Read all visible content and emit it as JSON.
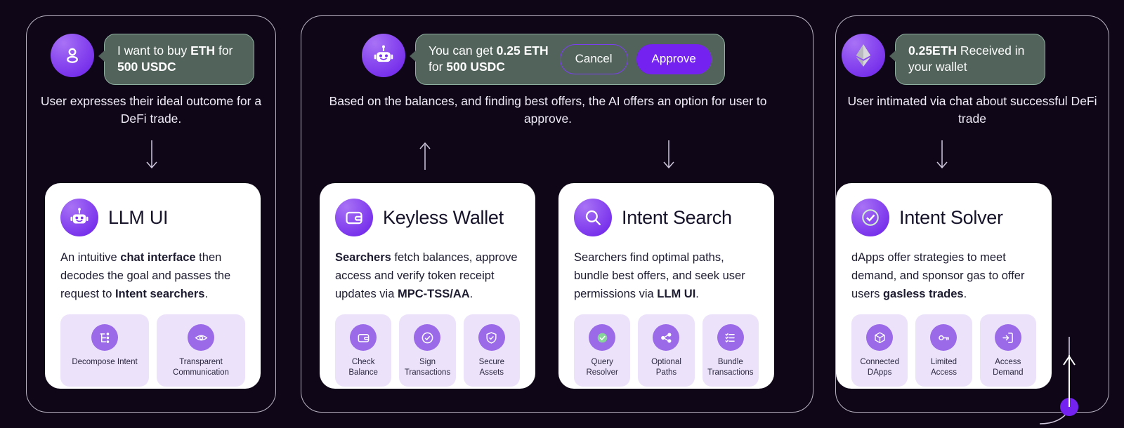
{
  "theme": {
    "background": "#0f0718",
    "panel_border": "#b9b3c4",
    "bubble_bg": "#51635a",
    "bubble_border": "#8fb0a0",
    "accent_purple": "#7322f0",
    "chip_bg": "#ece3fb",
    "chip_icon_bg": "#9a6ae8",
    "card_bg": "#ffffff",
    "caption_color": "#efeaf6",
    "green_check": "#86d49a"
  },
  "panels": [
    {
      "name": "user-panel",
      "chat": {
        "avatar_icon": "user-icon",
        "message_parts": [
          {
            "text": "I want to buy ",
            "bold": false
          },
          {
            "text": "ETH",
            "bold": true
          },
          {
            "text": " for ",
            "bold": false
          },
          {
            "text": "500 USDC",
            "bold": true
          }
        ],
        "plain_message": "I want to buy ETH for 500 USDC",
        "buttons": []
      },
      "caption": "User expresses their ideal outcome for a DeFi trade.",
      "arrow": "down-arrow-icon"
    },
    {
      "name": "ai-panel",
      "chat": {
        "avatar_icon": "robot-icon",
        "message_parts": [
          {
            "text": "You can get ",
            "bold": false
          },
          {
            "text": "0.25 ETH",
            "bold": true
          },
          {
            "text": " for ",
            "bold": false
          },
          {
            "text": "500 USDC",
            "bold": true
          }
        ],
        "plain_message": "You can get 0.25 ETH for 500 USDC",
        "buttons": [
          {
            "label": "Cancel",
            "style": "outline"
          },
          {
            "label": "Approve",
            "style": "filled"
          }
        ]
      },
      "caption": "Based on the balances, and finding best offers, the AI offers an option for user to approve.",
      "arrows": [
        "up-arrow-icon",
        "down-arrow-icon"
      ]
    },
    {
      "name": "result-panel",
      "chat": {
        "avatar_icon": "ethereum-icon",
        "message_parts": [
          {
            "text": "0.25ETH",
            "bold": true
          },
          {
            "text": " Received in your wallet",
            "bold": false
          }
        ],
        "plain_message": "0.25ETH Received in your wallet",
        "buttons": []
      },
      "caption": "User intimated via chat about successful DeFi trade",
      "arrow": "down-arrow-icon"
    }
  ],
  "cards": [
    {
      "id": "llm-ui",
      "icon": "robot-icon",
      "title": "LLM UI",
      "description_parts": [
        {
          "text": "An intuitive ",
          "bold": false
        },
        {
          "text": "chat interface",
          "bold": true
        },
        {
          "text": " then decodes the goal and passes the request to ",
          "bold": false
        },
        {
          "text": "Intent searchers",
          "bold": true
        },
        {
          "text": ".",
          "bold": false
        }
      ],
      "chips": [
        {
          "icon": "decompose-icon",
          "label": "Decompose Intent"
        },
        {
          "icon": "eye-icon",
          "label": "Transparent\nCommunication"
        }
      ]
    },
    {
      "id": "keyless-wallet",
      "icon": "wallet-icon",
      "title": "Keyless Wallet",
      "description_parts": [
        {
          "text": "Searchers",
          "bold": true
        },
        {
          "text": " fetch balances, approve access and verify token receipt updates via ",
          "bold": false
        },
        {
          "text": "MPC-TSS/AA",
          "bold": true
        },
        {
          "text": ".",
          "bold": false
        }
      ],
      "chips": [
        {
          "icon": "wallet-icon",
          "label": "Check\nBalance"
        },
        {
          "icon": "check-circle-icon",
          "label": "Sign\nTransactions"
        },
        {
          "icon": "shield-check-icon",
          "label": "Secure\nAssets"
        }
      ]
    },
    {
      "id": "intent-search",
      "icon": "search-icon",
      "title": "Intent Search",
      "description_parts": [
        {
          "text": "Searchers find optimal paths, bundle best offers, and seek user permissions via ",
          "bold": false
        },
        {
          "text": "LLM UI",
          "bold": true
        },
        {
          "text": ".",
          "bold": false
        }
      ],
      "chips": [
        {
          "icon": "green-check-icon",
          "label": "Query\nResolver"
        },
        {
          "icon": "branch-icon",
          "label": "Optional\nPaths"
        },
        {
          "icon": "list-icon",
          "label": "Bundle\nTransactions"
        }
      ]
    },
    {
      "id": "intent-solver",
      "icon": "check-circle-icon",
      "title": "Intent Solver",
      "description_parts": [
        {
          "text": "dApps offer strategies to meet demand, and sponsor gas to offer users ",
          "bold": false
        },
        {
          "text": "gasless trades",
          "bold": true
        },
        {
          "text": ".",
          "bold": false
        }
      ],
      "chips": [
        {
          "icon": "cube-icon",
          "label": "Connected\nDApps"
        },
        {
          "icon": "key-icon",
          "label": "Limited\nAccess"
        },
        {
          "icon": "login-icon",
          "label": "Access\nDemand"
        }
      ]
    }
  ],
  "connector": {
    "icon": "up-arrow-icon",
    "dot_color": "#7322f0"
  }
}
